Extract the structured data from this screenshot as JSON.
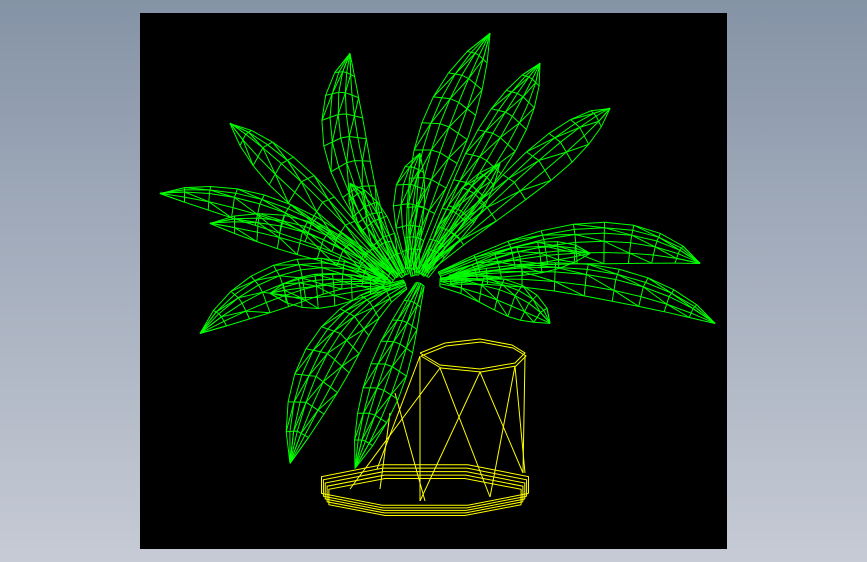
{
  "window": {
    "background_top": "#8593a6",
    "background_bottom": "#c6cbd5"
  },
  "viewport": {
    "background": "#000000",
    "model": {
      "name": "potted-plant-wireframe",
      "render_mode": "wireframe",
      "leaves_color": "#00ff00",
      "pot_color": "#ffff00"
    }
  }
}
